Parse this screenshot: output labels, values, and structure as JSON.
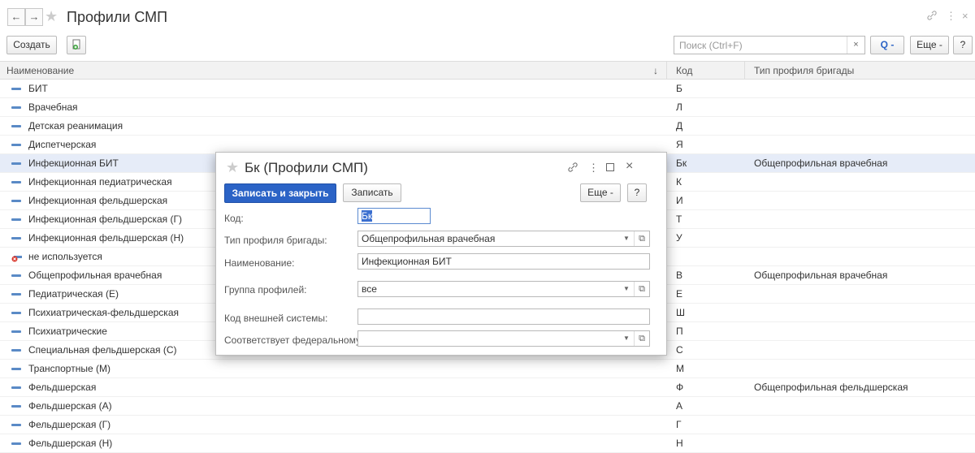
{
  "window": {
    "title": "Профили СМП",
    "back_icon": "←",
    "forward_icon": "→",
    "star_icon": "★",
    "link_icon": "🔗",
    "more_icon": "⋮",
    "close_icon": "×"
  },
  "toolbar": {
    "create_label": "Создать",
    "search_placeholder": "Поиск (Ctrl+F)",
    "clear_label": "×",
    "search_button": "Q -",
    "more_label": "Еще -",
    "help_label": "?"
  },
  "table": {
    "columns": [
      "Наименование",
      "Код",
      "Тип профиля бригады"
    ],
    "sort_indicator": "↓",
    "rows": [
      {
        "name": "БИТ",
        "code": "Б",
        "type": ""
      },
      {
        "name": "Врачебная",
        "code": "Л",
        "type": ""
      },
      {
        "name": "Детская реанимация",
        "code": "Д",
        "type": ""
      },
      {
        "name": "Диспетчерская",
        "code": "Я",
        "type": ""
      },
      {
        "name": "Инфекционная БИТ",
        "code": "Бк",
        "type": "Общепрофильная врачебная"
      },
      {
        "name": "Инфекционная педиатрическая",
        "code": "К",
        "type": ""
      },
      {
        "name": "Инфекционная фельдшерская",
        "code": "И",
        "type": ""
      },
      {
        "name": "Инфекционная фельдшерская (Г)",
        "code": "Т",
        "type": ""
      },
      {
        "name": "Инфекционная фельдшерская (Н)",
        "code": "У",
        "type": ""
      },
      {
        "name": "не используется",
        "code": "",
        "type": ""
      },
      {
        "name": "Общепрофильная врачебная",
        "code": "В",
        "type": "Общепрофильная врачебная"
      },
      {
        "name": "Педиатрическая (Е)",
        "code": "Е",
        "type": ""
      },
      {
        "name": "Психиатрическая-фельдшерская",
        "code": "Ш",
        "type": ""
      },
      {
        "name": "Психиатрические",
        "code": "П",
        "type": ""
      },
      {
        "name": "Специальная фельдшерская (С)",
        "code": "С",
        "type": ""
      },
      {
        "name": "Транспортные (М)",
        "code": "М",
        "type": ""
      },
      {
        "name": "Фельдшерская",
        "code": "Ф",
        "type": "Общепрофильная фельдшерская"
      },
      {
        "name": "Фельдшерская (А)",
        "code": "А",
        "type": ""
      },
      {
        "name": "Фельдшерская (Г)",
        "code": "Г",
        "type": ""
      },
      {
        "name": "Фельдшерская (Н)",
        "code": "Н",
        "type": ""
      }
    ]
  },
  "dialog": {
    "title": "Бк (Профили СМП)",
    "save_close_label": "Записать и закрыть",
    "save_label": "Записать",
    "more_label": "Еще -",
    "help_label": "?",
    "fields": {
      "code_label": "Код:",
      "code_value": "Бк",
      "brigade_type_label": "Тип профиля бригады:",
      "brigade_type_value": "Общепрофильная врачебная",
      "name_label": "Наименование:",
      "name_value": "Инфекционная БИТ",
      "group_label": "Группа профилей:",
      "group_value": "все",
      "ext_code_label": "Код внешней системы:",
      "ext_code_value": "",
      "federal_label": "Соответствует федеральному:",
      "federal_value": ""
    }
  }
}
